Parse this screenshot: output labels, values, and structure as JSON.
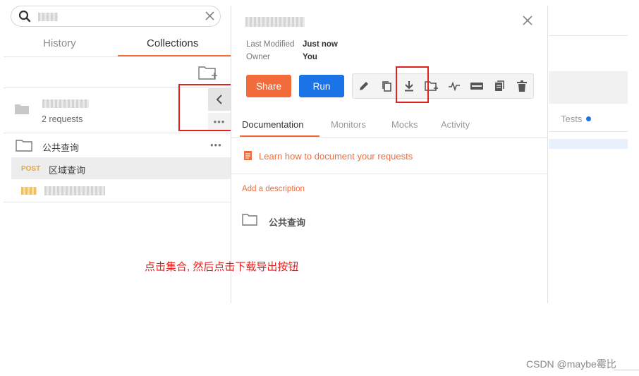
{
  "sidebar": {
    "tabs": [
      {
        "label": "History",
        "active": false
      },
      {
        "label": "Collections",
        "active": true
      }
    ],
    "collection": {
      "request_count": "2 requests",
      "more_label": "•••"
    },
    "folder": {
      "name": "公共查询",
      "more_label": "•••"
    },
    "request": {
      "method": "POST",
      "name": "区域查询"
    }
  },
  "panel": {
    "meta": [
      {
        "key": "Last Modified",
        "value": "Just now"
      },
      {
        "key": "Owner",
        "value": "You"
      }
    ],
    "share_label": "Share",
    "run_label": "Run",
    "toolbar_icons": [
      "edit-icon",
      "duplicate-icon",
      "download-icon",
      "add-folder-icon",
      "monitor-icon",
      "mock-icon",
      "docs-icon",
      "trash-icon"
    ],
    "tabs": [
      {
        "label": "Documentation",
        "active": true
      },
      {
        "label": "Monitors",
        "active": false
      },
      {
        "label": "Mocks",
        "active": false
      },
      {
        "label": "Activity",
        "active": false
      }
    ],
    "learn_link": "Learn how to document your requests",
    "add_description": "Add a description",
    "folder_name": "公共查询"
  },
  "background": {
    "tests_tab": "Tests"
  },
  "annotation": {
    "instruction": "点击集合, 然后点击下载导出按钮"
  },
  "watermark": "CSDN @maybe霉比",
  "colors": {
    "accent_orange": "#f26b3a",
    "run_blue": "#1b73e8",
    "annotation_red": "#e3211e",
    "post_method": "#e8a534"
  }
}
